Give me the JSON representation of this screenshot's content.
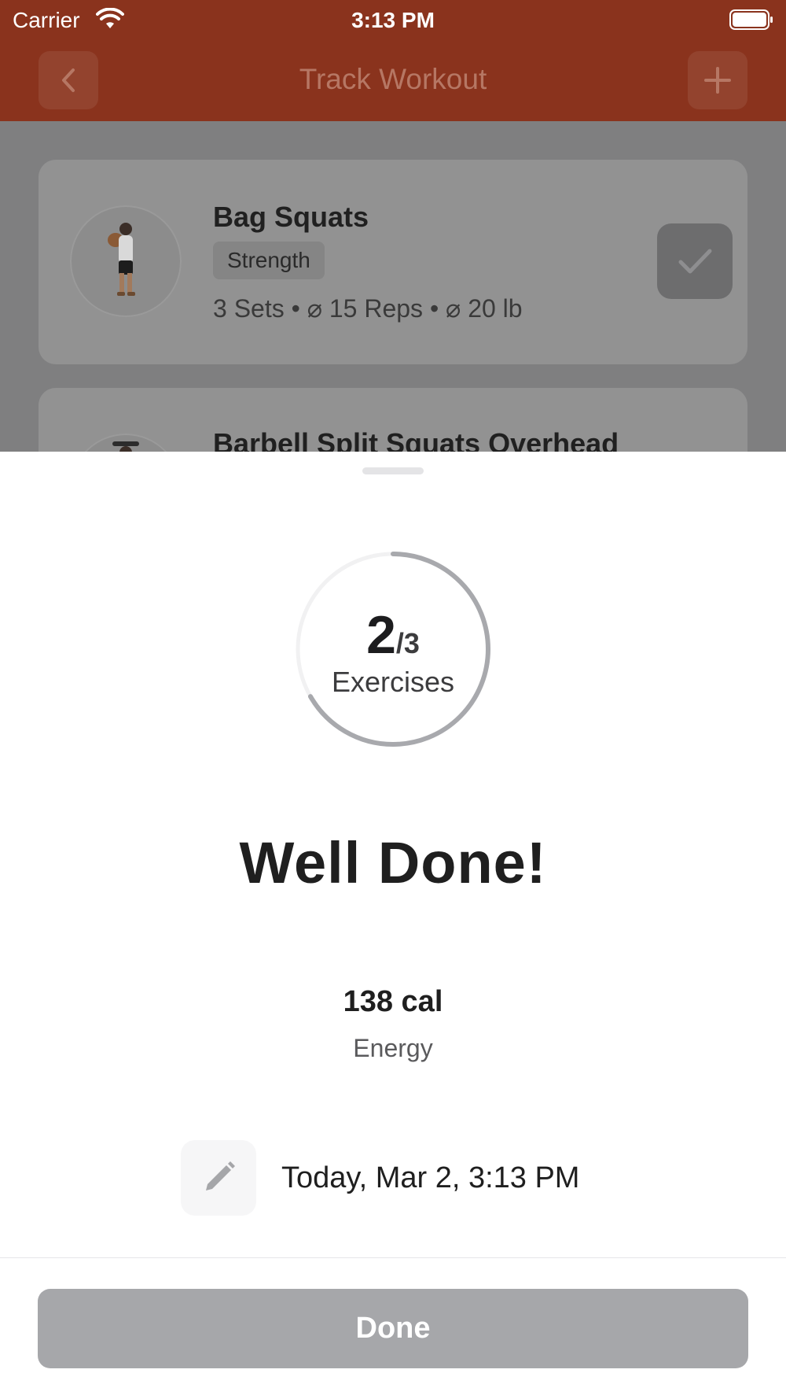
{
  "status_bar": {
    "carrier": "Carrier",
    "time": "3:13 PM",
    "wifi_icon": "wifi-icon",
    "battery_icon": "battery-icon"
  },
  "nav": {
    "title": "Track Workout",
    "back_icon": "chevron-left-icon",
    "add_icon": "plus-icon",
    "bar_color": "#8a331d"
  },
  "exercises": [
    {
      "name": "Bag Squats",
      "category": "Strength",
      "summary": "3 Sets • ⌀ 15 Reps • ⌀ 20 lb",
      "completed": true
    },
    {
      "name": "Barbell Split Squats Overhead"
    }
  ],
  "summary_sheet": {
    "progress": {
      "completed": 2,
      "total_label": "/3",
      "total": 3,
      "unit": "Exercises",
      "fraction": 0.667
    },
    "headline": "Well Done!",
    "energy": {
      "value": "138 cal",
      "label": "Energy"
    },
    "date": "Today, Mar 2, 3:13 PM",
    "edit_icon": "pencil-icon",
    "done_label": "Done"
  },
  "colors": {
    "accent_dimmed": "#8a331d",
    "progress_ring": "#a8a9ad",
    "done_button": "#a6a7aa"
  }
}
